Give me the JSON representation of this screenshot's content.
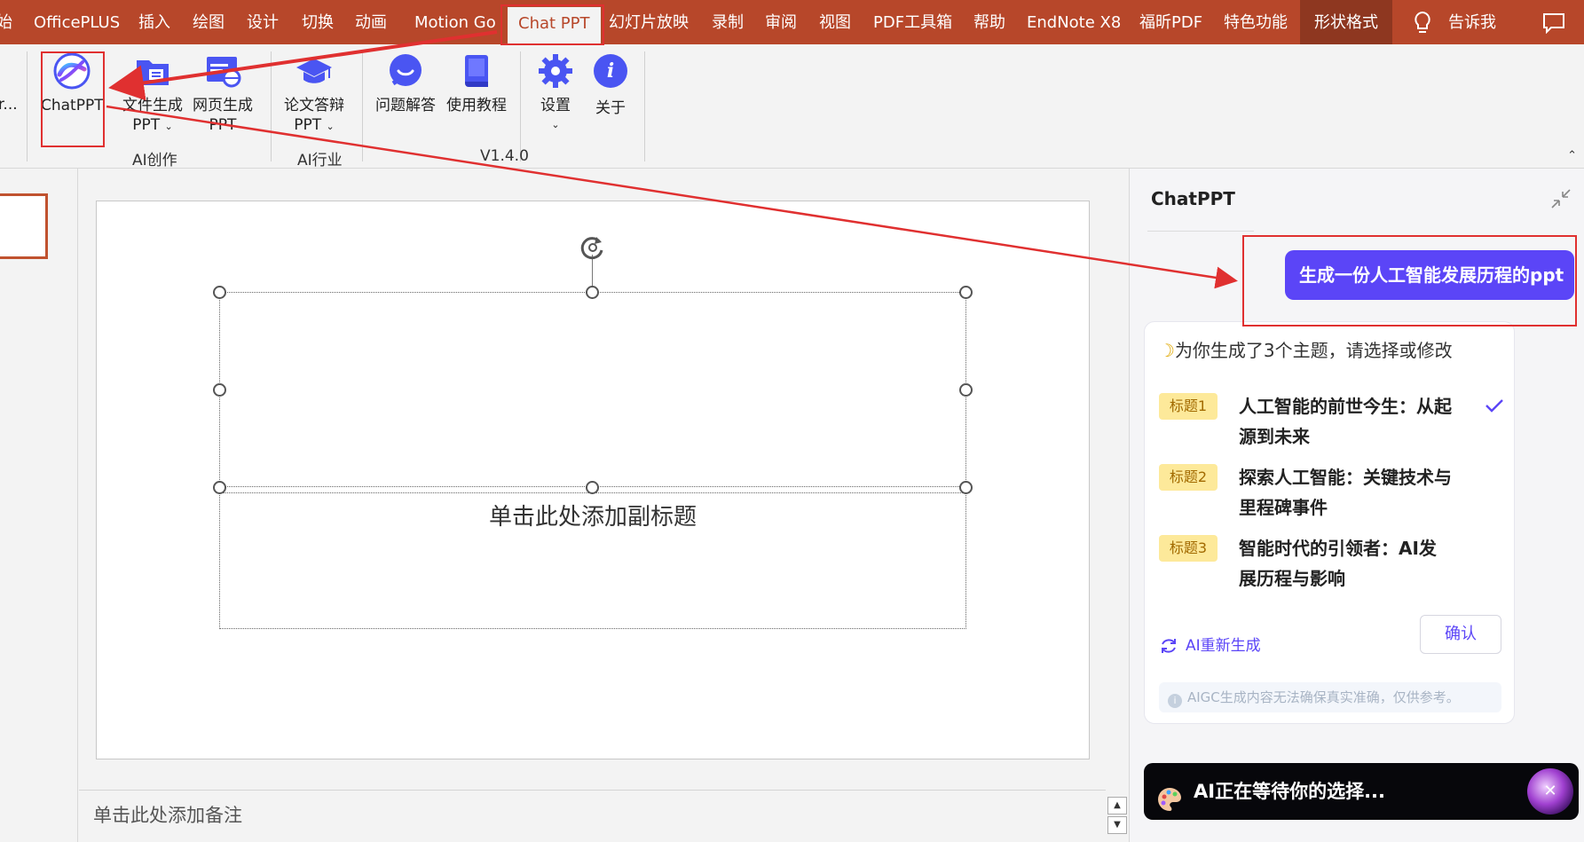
{
  "menubar": {
    "tabs": [
      "始",
      "OfficePLUS",
      "插入",
      "绘图",
      "设计",
      "切换",
      "动画",
      "Motion Go",
      "Chat PPT",
      "幻灯片放映",
      "录制",
      "审阅",
      "视图",
      "PDF工具箱",
      "帮助",
      "EndNote X8",
      "福昕PDF",
      "特色功能",
      "形状格式",
      "告诉我"
    ],
    "active_tab": "Chat PPT"
  },
  "ribbon": {
    "left_cut_label": "r...",
    "buttons": {
      "chatppt": "ChatPPT",
      "file_gen_1": "文件生成",
      "file_gen_2": "PPT",
      "web_gen_1": "网页生成",
      "web_gen_2": "PPT",
      "thesis_1": "论文答辩",
      "thesis_2": "PPT",
      "qa": "问题解答",
      "tutorial": "使用教程",
      "settings": "设置",
      "about": "关于"
    },
    "groups": {
      "ai_create": "AI创作",
      "ai_industry": "AI行业",
      "version": "V1.4.0"
    }
  },
  "slide": {
    "subtitle_placeholder": "单击此处添加副标题"
  },
  "notes": {
    "placeholder": "单击此处添加备注"
  },
  "panel": {
    "title": "ChatPPT",
    "user_message": "生成一份人工智能发展历程的ppt",
    "card_header": "为你生成了3个主题，请选择或修改",
    "topics": [
      {
        "tag": "标题1",
        "text": "人工智能的前世今生：从起源到未来",
        "selected": true
      },
      {
        "tag": "标题2",
        "text": "探索人工智能：关键技术与里程碑事件",
        "selected": false
      },
      {
        "tag": "标题3",
        "text": "智能时代的引领者：AI发展历程与影响",
        "selected": false
      }
    ],
    "regenerate": "AI重新生成",
    "confirm": "确认",
    "notice": "AIGC生成内容无法确保真实准确，仅供参考。",
    "waiting": "AI正在等待你的选择..."
  },
  "colors": {
    "brand_red": "#b7472a",
    "accent_purple": "#5b45f7",
    "annotation_red": "#e03030"
  }
}
